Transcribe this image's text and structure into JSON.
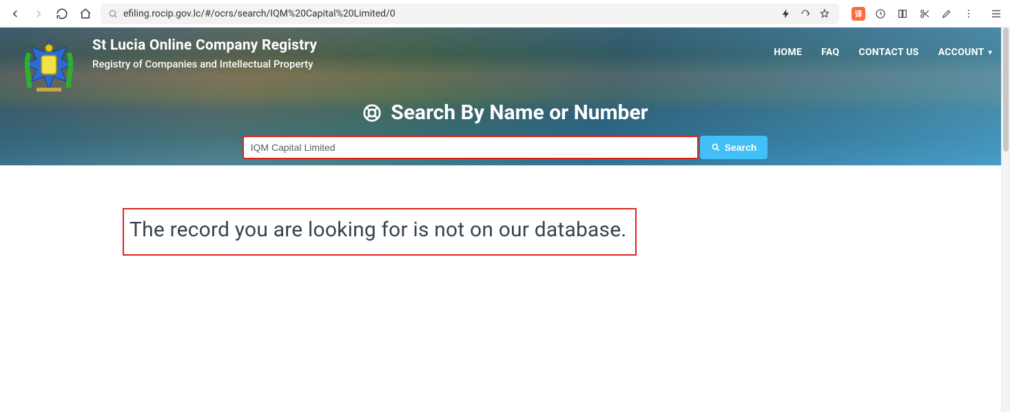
{
  "browser": {
    "url": "efiling.rocip.gov.lc/#/ocrs/search/IQM%20Capital%20Limited/0"
  },
  "site": {
    "title": "St Lucia Online Company Registry",
    "subtitle": "Registry of Companies and Intellectual Property"
  },
  "nav": {
    "home": "HOME",
    "faq": "FAQ",
    "contact": "CONTACT US",
    "account": "ACCOUNT"
  },
  "search": {
    "heading": "Search By Name or Number",
    "value": "IQM Capital Limited",
    "button": "Search"
  },
  "result": {
    "message": "The record you are looking for is not on our database."
  }
}
